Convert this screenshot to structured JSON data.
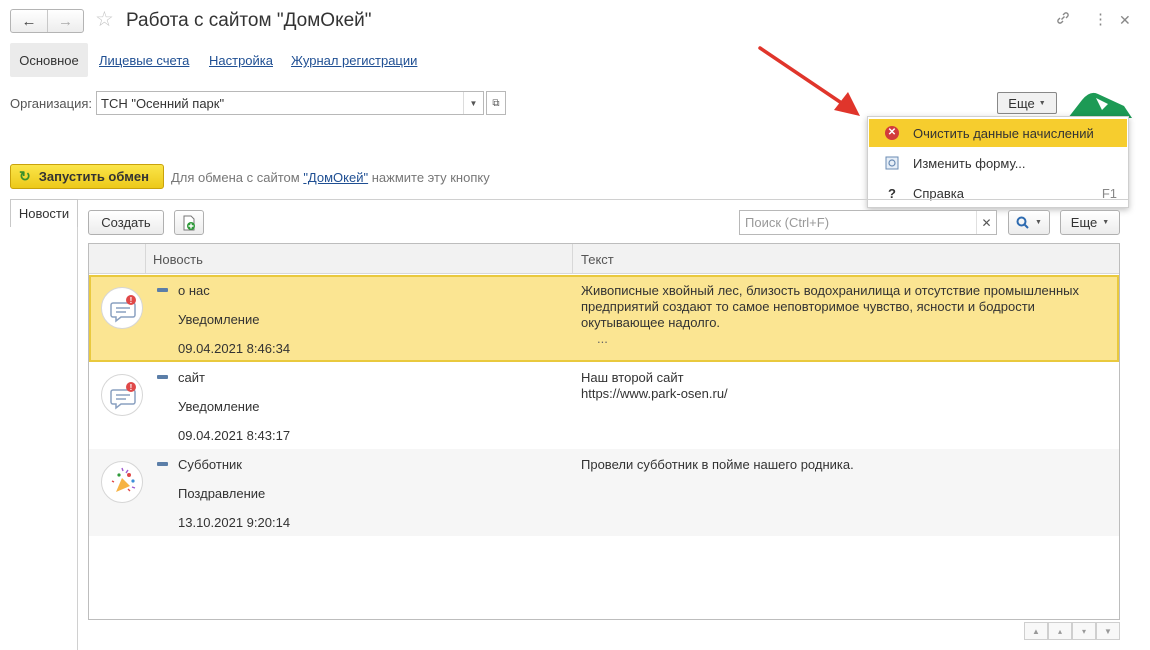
{
  "window": {
    "title": "Работа с сайтом \"ДомОкей\""
  },
  "tabs": [
    {
      "label": "Основное",
      "active": true
    },
    {
      "label": "Лицевые счета"
    },
    {
      "label": "Настройка"
    },
    {
      "label": "Журнал регистрации"
    }
  ],
  "organization": {
    "label": "Организация:",
    "value": "ТСН \"Осенний парк\""
  },
  "more_button": {
    "label": "Еще"
  },
  "menu": {
    "items": [
      {
        "label": "Очистить данные начислений",
        "icon": "clear-icon",
        "highlighted": true,
        "shortcut": ""
      },
      {
        "label": "Изменить форму...",
        "icon": "form-settings-icon",
        "shortcut": ""
      },
      {
        "label": "Справка",
        "icon": "help-icon",
        "shortcut": "F1"
      }
    ]
  },
  "exchange": {
    "button_label": "Запустить обмен",
    "hint_before": "Для обмена с сайтом ",
    "hint_link": "\"ДомОкей\"",
    "hint_after": " нажмите эту кнопку"
  },
  "news_tab": {
    "label": "Новости"
  },
  "toolbar": {
    "create_label": "Создать",
    "search_placeholder": "Поиск (Ctrl+F)",
    "more_label": "Еще"
  },
  "table": {
    "columns": [
      "Новость",
      "Текст"
    ],
    "rows": [
      {
        "title": "о нас",
        "type": "Уведомление",
        "date": "09.04.2021 8:46:34",
        "text": "Живописные хвойный лес, близость  водохранилища и отсутствие промышленных предприятий создают то самое неповторимое чувство, ясности и бодрости окутывающее надолго.",
        "text_more": "...",
        "icon": "notification-icon",
        "selected": true
      },
      {
        "title": "сайт",
        "type": "Уведомление",
        "date": "09.04.2021 8:43:17",
        "text_line1": "Наш второй сайт",
        "text_line2": "https://www.park-osen.ru/",
        "icon": "notification-icon"
      },
      {
        "title": "Субботник",
        "type": "Поздравление",
        "date": "13.10.2021 9:20:14",
        "text": "Провели субботник в пойме нашего родника.",
        "icon": "celebration-icon"
      }
    ]
  },
  "colors": {
    "highlight": "#f6cd2e",
    "selected_row": "#fbe592",
    "link": "#1f4f93",
    "arrow": "#e0352b",
    "run_button": "#f3d62c"
  }
}
